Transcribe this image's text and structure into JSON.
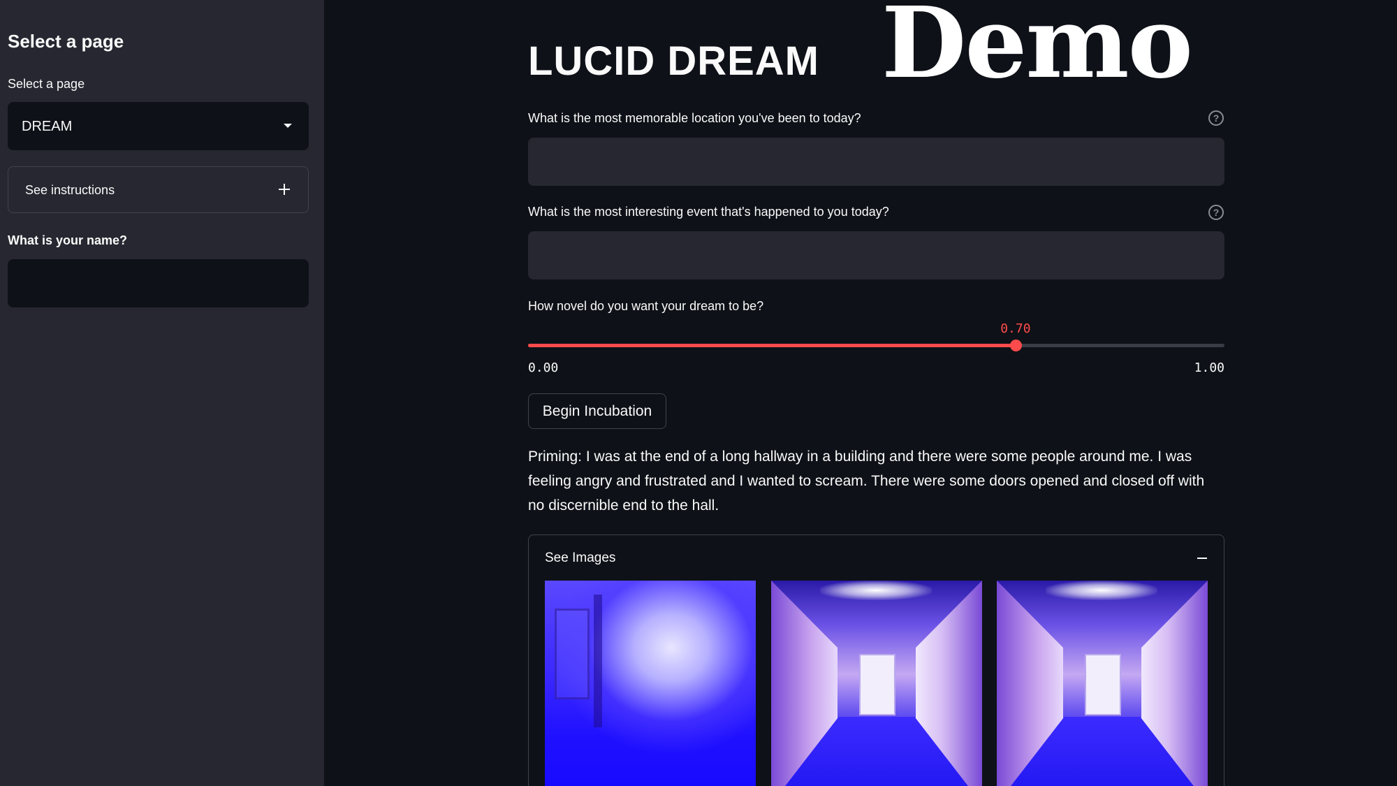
{
  "sidebar": {
    "heading": "Select a page",
    "select_label": "Select a page",
    "select_value": "DREAM",
    "expander_label": "See instructions",
    "name_label": "What is your name?",
    "name_value": ""
  },
  "main": {
    "title": "LUCID DREAM",
    "overlay_text": "Demo",
    "q1_label": "What is the most memorable location you've been to today?",
    "q1_value": "",
    "q2_label": "What is the most interesting event that's happened to you today?",
    "q2_value": "",
    "slider": {
      "label": "How novel do you want your dream to be?",
      "value": 0.7,
      "value_text": "0.70",
      "min_text": "0.00",
      "max_text": "1.00",
      "color": "#ff4b4b"
    },
    "button_label": "Begin Incubation",
    "priming_text": "Priming: I was at the end of a long hallway in a building and there were some people around me. I was feeling angry and frustrated and I wanted to scream. There were some doors opened and closed off with no discernible end to the hall.",
    "images_expander_label": "See Images"
  },
  "theme": {
    "background": "#0e1117",
    "sidebar_background": "#262730",
    "accent": "#ff4b4b"
  }
}
